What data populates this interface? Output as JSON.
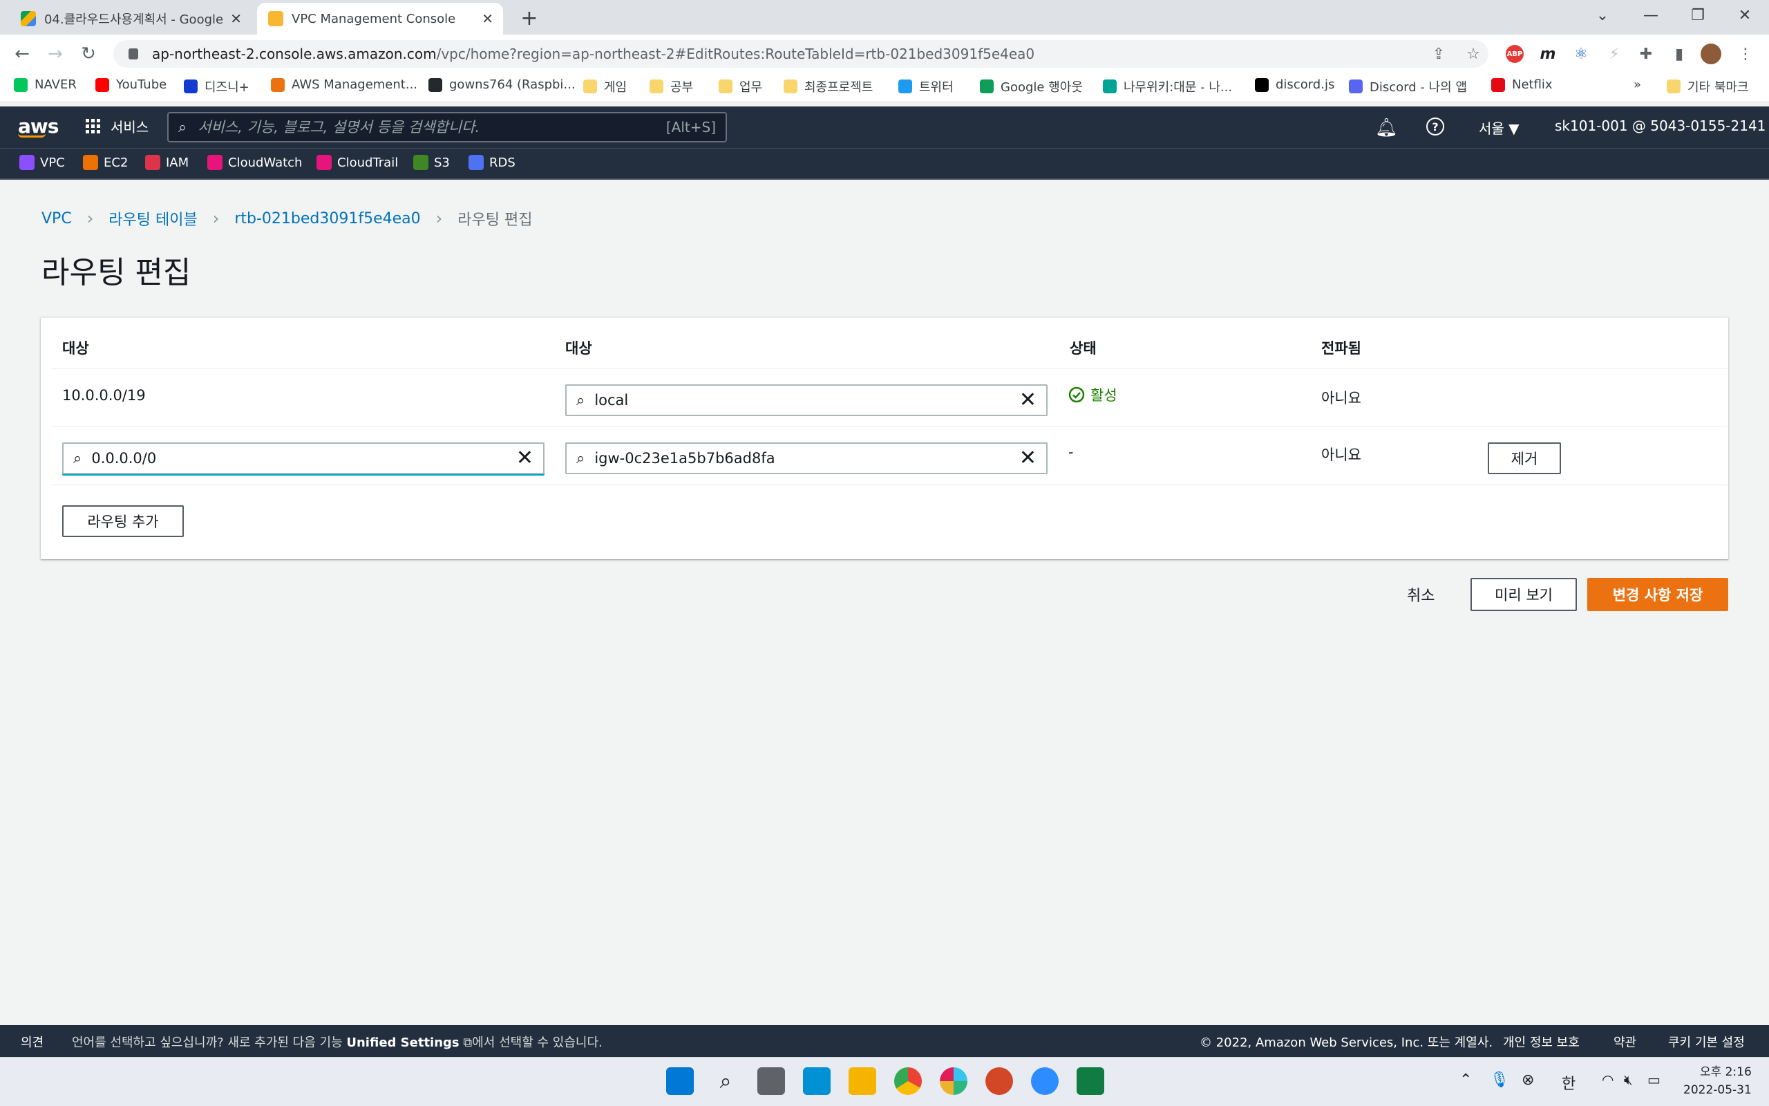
{
  "browser": {
    "tabs": [
      {
        "title": "04.클라우드사용계획서 - Google",
        "active": false
      },
      {
        "title": "VPC Management Console",
        "active": true
      }
    ],
    "url_host": "ap-northeast-2.console.aws.amazon.com",
    "url_path": "/vpc/home?region=ap-northeast-2#EditRoutes:RouteTableId=rtb-021bed3091f5e4ea0",
    "bookmarks": [
      {
        "label": "NAVER",
        "color": "#03c75a"
      },
      {
        "label": "YouTube",
        "color": "#ff0000"
      },
      {
        "label": "디즈니+",
        "color": "#113ccf"
      },
      {
        "label": "AWS Management...",
        "color": "#ec7211"
      },
      {
        "label": "gowns764 (Raspbi...",
        "color": "#24292e"
      },
      {
        "label": "게임",
        "color": "#f9d66d"
      },
      {
        "label": "공부",
        "color": "#f9d66d"
      },
      {
        "label": "업무",
        "color": "#f9d66d"
      },
      {
        "label": "최종프로젝트",
        "color": "#f9d66d"
      },
      {
        "label": "트위터",
        "color": "#1d9bf0"
      },
      {
        "label": "Google 행아웃",
        "color": "#0f9d58"
      },
      {
        "label": "나무위키:대문 - 나...",
        "color": "#00a495"
      },
      {
        "label": "discord.js",
        "color": "#000000"
      },
      {
        "label": "Discord - 나의 앱",
        "color": "#5865f2"
      },
      {
        "label": "Netflix",
        "color": "#e50914"
      }
    ],
    "bookmarks_more": "»",
    "other_bookmarks": "기타 북마크"
  },
  "aws_nav": {
    "logo": "aws",
    "services_label": "서비스",
    "search_placeholder": "서비스, 기능, 블로그, 설명서 등을 검색합니다.",
    "search_shortcut": "[Alt+S]",
    "region": "서울 ▼",
    "account": "sk101-001 @ 5043-0155-2141 ▼",
    "favorites": [
      {
        "label": "VPC",
        "color": "#8c4fff"
      },
      {
        "label": "EC2",
        "color": "#ed7100"
      },
      {
        "label": "IAM",
        "color": "#dd344c"
      },
      {
        "label": "CloudWatch",
        "color": "#e7157b"
      },
      {
        "label": "CloudTrail",
        "color": "#e7157b"
      },
      {
        "label": "S3",
        "color": "#3f8624"
      },
      {
        "label": "RDS",
        "color": "#4d72f3"
      }
    ]
  },
  "breadcrumb": {
    "items": [
      "VPC",
      "라우팅 테이블",
      "rtb-021bed3091f5e4ea0"
    ],
    "current": "라우팅 편집"
  },
  "page": {
    "title": "라우팅 편집"
  },
  "routes_table": {
    "headers": [
      "대상",
      "대상",
      "상태",
      "전파됨"
    ],
    "rows": [
      {
        "destination": "10.0.0.0/19",
        "target": "local",
        "status": "활성",
        "propagated": "아니요"
      },
      {
        "destination": "0.0.0.0/0",
        "target": "igw-0c23e1a5b7b6ad8fa",
        "status": "-",
        "propagated": "아니요",
        "remove_label": "제거"
      }
    ],
    "add_route_label": "라우팅 추가"
  },
  "actions": {
    "cancel": "취소",
    "preview": "미리 보기",
    "save": "변경 사항 저장"
  },
  "footer": {
    "feedback": "의견",
    "language_prefix": "언어를 선택하고 싶으십니까? 새로 추가된 다음 기능 ",
    "language_link": "Unified Settings",
    "language_suffix": "에서 선택할 수 있습니다.",
    "copyright": "© 2022, Amazon Web Services, Inc. 또는 계열사.",
    "privacy": "개인 정보 보호",
    "terms": "약관",
    "cookies": "쿠키 기본 설정"
  },
  "taskbar": {
    "ime": "한",
    "time": "오후 2:16",
    "date": "2022-05-31"
  },
  "colors": {
    "aws_nav_bg": "#232f3e",
    "link": "#0073bb",
    "primary_button": "#ec7211",
    "status_success": "#1d8102"
  }
}
